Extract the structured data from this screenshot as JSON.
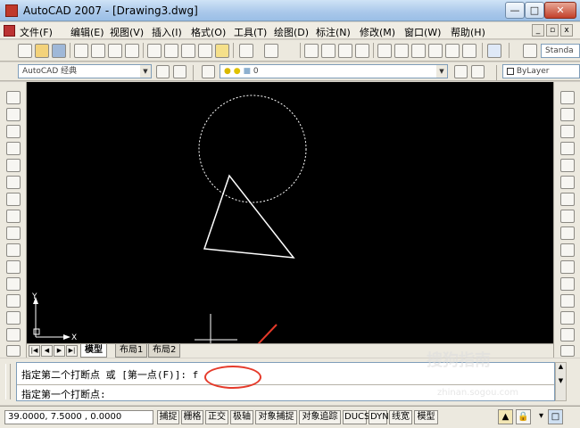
{
  "window": {
    "title": "AutoCAD 2007 - [Drawing3.dwg]",
    "minimize": "—",
    "maximize": "□",
    "close": "✕"
  },
  "menu": {
    "items": [
      "文件(F)",
      "编辑(E)",
      "视图(V)",
      "插入(I)",
      "格式(O)",
      "工具(T)",
      "绘图(D)",
      "标注(N)",
      "修改(M)",
      "窗口(W)",
      "帮助(H)"
    ]
  },
  "toolbar": {
    "workspace": "AutoCAD 经典",
    "layer": "0",
    "text_style": "Standa",
    "linetype": "ByLayer"
  },
  "tabs": {
    "items": [
      "模型",
      "布局1",
      "布局2"
    ],
    "active": "模型"
  },
  "ucs": {
    "y_label": "Y",
    "x_label": "X"
  },
  "command": {
    "history_line": "指定第二个打断点 或 [第一点(F)]: f",
    "prompt": "指定第一个打断点:"
  },
  "status": {
    "coords": "39.0000, 7.5000 , 0.0000",
    "buttons": [
      "捕捉",
      "栅格",
      "正交",
      "极轴",
      "对象捕捉",
      "对象追踪",
      "DUCS",
      "DYN",
      "线宽",
      "模型"
    ]
  },
  "watermark": {
    "text": "搜狗指南",
    "url": "zhinan.sogou.com"
  },
  "colors": {
    "canvas": "#000000",
    "entity": "#ffffff",
    "annotation": "#e53a2a"
  }
}
